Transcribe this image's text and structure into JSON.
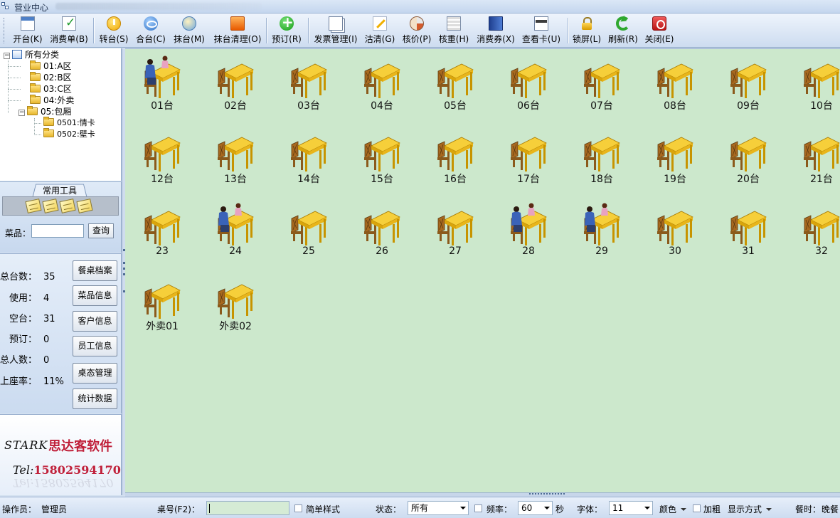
{
  "window": {
    "title": "营业中心"
  },
  "toolbar": {
    "buttons": [
      {
        "label": "开台(K)",
        "icon": "open-table-icon"
      },
      {
        "label": "消费单(B)",
        "icon": "bill-check-icon"
      },
      {
        "label": "转台(S)",
        "icon": "transfer-table-icon"
      },
      {
        "label": "合台(C)",
        "icon": "merge-table-icon"
      },
      {
        "label": "抹台(M)",
        "icon": "wipe-table-icon"
      },
      {
        "label": "抹台清理(O)",
        "icon": "wipe-clean-icon"
      },
      {
        "label": "预订(R)",
        "icon": "reserve-plus-icon"
      },
      {
        "label": "发票管理(I)",
        "icon": "invoice-icon"
      },
      {
        "label": "沽清(G)",
        "icon": "sold-out-icon"
      },
      {
        "label": "核价(P)",
        "icon": "price-check-icon"
      },
      {
        "label": "核重(H)",
        "icon": "weight-check-icon"
      },
      {
        "label": "消费券(X)",
        "icon": "coupon-book-icon"
      },
      {
        "label": "查看卡(U)",
        "icon": "view-card-icon"
      },
      {
        "label": "锁屏(L)",
        "icon": "lock-icon"
      },
      {
        "label": "刷新(R)",
        "icon": "refresh-icon"
      },
      {
        "label": "关闭(E)",
        "icon": "power-close-icon"
      }
    ]
  },
  "tree": {
    "root": "所有分类",
    "nodes": [
      {
        "label": "01:A区"
      },
      {
        "label": "02:B区"
      },
      {
        "label": "03:C区"
      },
      {
        "label": "04:外卖"
      },
      {
        "label": "05:包厢"
      },
      {
        "label": "0501:情卡"
      },
      {
        "label": "0502:壁卡"
      }
    ]
  },
  "tools": {
    "tab_label": "常用工具",
    "dish_label": "菜品：",
    "dish_value": "",
    "query_label": "查询"
  },
  "stats": {
    "items": [
      {
        "label": "总台数：",
        "value": "35"
      },
      {
        "label": "使用：",
        "value": "4"
      },
      {
        "label": "空台：",
        "value": "31"
      },
      {
        "label": "预订：",
        "value": "0"
      },
      {
        "label": "总人数：",
        "value": "0"
      },
      {
        "label": "上座率：",
        "value": "11%"
      }
    ],
    "buttons": [
      "餐桌档案",
      "菜品信息",
      "客户信息",
      "员工信息",
      "桌态管理",
      "统计数据"
    ]
  },
  "brand": {
    "name_en": "STARK",
    "name_cn": "思达客软件",
    "tel_label": "Tel:",
    "tel_number": "15802594170"
  },
  "tables": [
    {
      "label": "01台",
      "occupied": true
    },
    {
      "label": "02台",
      "occupied": false
    },
    {
      "label": "03台",
      "occupied": false
    },
    {
      "label": "04台",
      "occupied": false
    },
    {
      "label": "05台",
      "occupied": false
    },
    {
      "label": "06台",
      "occupied": false
    },
    {
      "label": "07台",
      "occupied": false
    },
    {
      "label": "08台",
      "occupied": false
    },
    {
      "label": "09台",
      "occupied": false
    },
    {
      "label": "10台",
      "occupied": false
    },
    {
      "label": "12台",
      "occupied": false
    },
    {
      "label": "13台",
      "occupied": false
    },
    {
      "label": "14台",
      "occupied": false
    },
    {
      "label": "15台",
      "occupied": false
    },
    {
      "label": "16台",
      "occupied": false
    },
    {
      "label": "17台",
      "occupied": false
    },
    {
      "label": "18台",
      "occupied": false
    },
    {
      "label": "19台",
      "occupied": false
    },
    {
      "label": "20台",
      "occupied": false
    },
    {
      "label": "21台",
      "occupied": false
    },
    {
      "label": "23",
      "occupied": false
    },
    {
      "label": "24",
      "occupied": true
    },
    {
      "label": "25",
      "occupied": false
    },
    {
      "label": "26",
      "occupied": false
    },
    {
      "label": "27",
      "occupied": false
    },
    {
      "label": "28",
      "occupied": true
    },
    {
      "label": "29",
      "occupied": true
    },
    {
      "label": "30",
      "occupied": false
    },
    {
      "label": "31",
      "occupied": false
    },
    {
      "label": "32",
      "occupied": false
    },
    {
      "label": "外卖01",
      "occupied": false
    },
    {
      "label": "外卖02",
      "occupied": false
    }
  ],
  "statusbar": {
    "operator_label": "操作员：",
    "operator_value": "管理员",
    "table_no_label": "桌号(F2)：",
    "table_no_value": "",
    "simple_style_label": "简单样式",
    "status_label": "状态：",
    "status_value": "所有",
    "frequency_label": "频率：",
    "frequency_value": "60",
    "seconds_label": "秒",
    "font_label": "字体：",
    "font_value": "11",
    "color_label": "颜色",
    "bold_label": "加粗",
    "display_mode_label": "显示方式",
    "meal_time_label": "餐时：",
    "meal_time_value": "晚餐"
  },
  "colors": {
    "main_background": "#cce8cc",
    "brand_red": "#c0203a",
    "table_top": "#f2c531",
    "chair": "#8b5a1b"
  }
}
